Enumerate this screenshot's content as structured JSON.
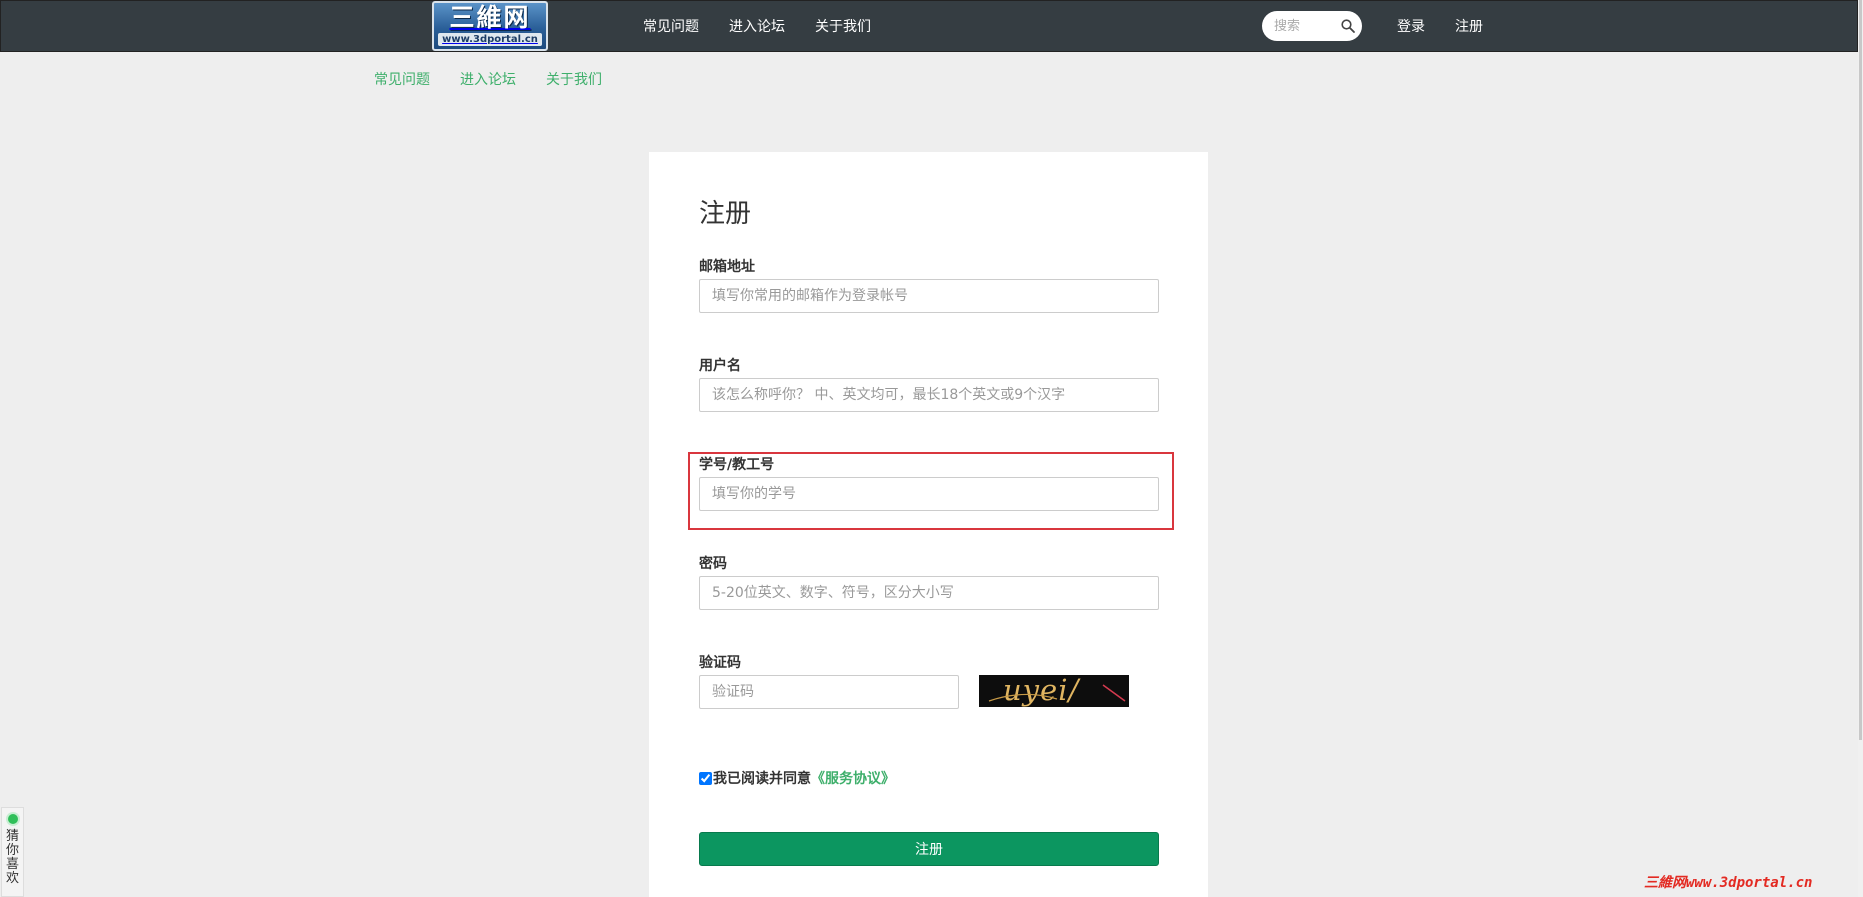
{
  "header": {
    "logo_main": "三維网",
    "logo_sub": "www.3dportal.cn",
    "nav": [
      {
        "label": "常见问题"
      },
      {
        "label": "进入论坛"
      },
      {
        "label": "关于我们"
      }
    ],
    "search_placeholder": "搜索",
    "login": "登录",
    "register": "注册"
  },
  "subnav": [
    {
      "label": "常见问题"
    },
    {
      "label": "进入论坛"
    },
    {
      "label": "关于我们"
    }
  ],
  "form": {
    "title": "注册",
    "fields": [
      {
        "label": "邮箱地址",
        "placeholder": "填写你常用的邮箱作为登录帐号",
        "value": ""
      },
      {
        "label": "用户名",
        "placeholder": "该怎么称呼你？ 中、英文均可，最长18个英文或9个汉字",
        "value": ""
      },
      {
        "label": "学号/教工号",
        "placeholder": "填写你的学号",
        "value": ""
      },
      {
        "label": "密码",
        "placeholder": "5-20位英文、数字、符号，区分大小写",
        "value": ""
      },
      {
        "label": "验证码",
        "placeholder": "验证码",
        "value": ""
      }
    ],
    "captcha_text": "uyei/",
    "agree_checked": true,
    "agree_text": "我已阅读并同意",
    "agree_link": "《服务协议》",
    "submit": "注册"
  },
  "side_widget": {
    "label": "猜你喜欢"
  },
  "watermark": "三維网www.3dportal.cn",
  "colors": {
    "topbar": "#353d42",
    "accent_green": "#3eaf6b",
    "button_green": "#0c9660",
    "highlight_red": "#d9363e"
  }
}
